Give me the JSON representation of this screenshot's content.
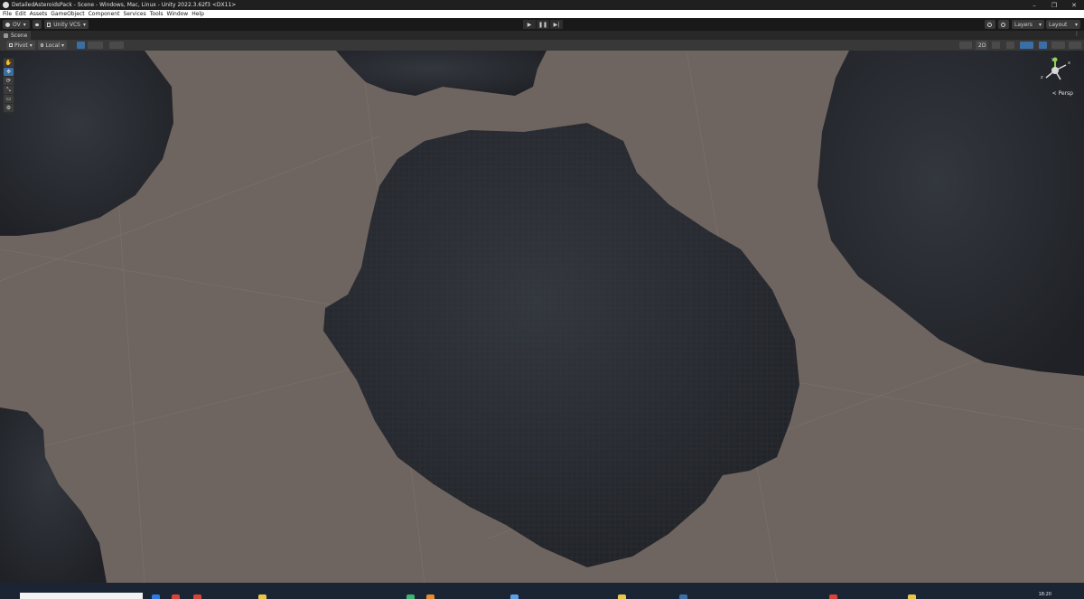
{
  "window": {
    "title": "DetailedAsteroidsPack - Scene - Windows, Mac, Linux - Unity 2022.3.62f3 <DX11>",
    "controls": [
      "–",
      "❐",
      "✕"
    ]
  },
  "menu": [
    "File",
    "Edit",
    "Assets",
    "GameObject",
    "Component",
    "Services",
    "Tools",
    "Window",
    "Help"
  ],
  "toolbar": {
    "account_label": "OV",
    "account_caret": "▾",
    "vcs_label": "Unity VCS",
    "play_icon": "▶",
    "pause_icon": "❚❚",
    "step_icon": "▶|",
    "layers_label": "Layers",
    "layout_label": "Layout"
  },
  "scene_tab": {
    "label": "Scene",
    "kebab": "⋮"
  },
  "scene_toolbar": {
    "pivot_label": "Pivot",
    "local_label": "Local",
    "two_d_label": "2D"
  },
  "tools": [
    "✋",
    "✥",
    "⟳",
    "⤡",
    "▭",
    "⚙"
  ],
  "viewport": {
    "background_color": "#6e6560",
    "rock_color": "#2a2d33",
    "camera_mode": "< Persp",
    "gizmo_labels": {
      "y": "y",
      "x": "x",
      "z": "z"
    }
  },
  "taskbar": {
    "time": "18:20"
  },
  "colors": {
    "accent": "#3a6ea5",
    "titlebar": "#1f1f1f",
    "menubar": "#ffffff",
    "toolbar": "#191919",
    "panel": "#383838"
  }
}
